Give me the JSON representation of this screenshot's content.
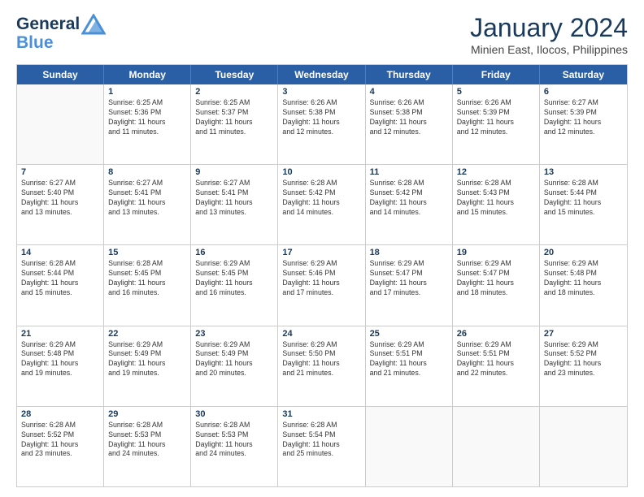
{
  "logo": {
    "line1": "General",
    "line2": "Blue"
  },
  "title": "January 2024",
  "subtitle": "Minien East, Ilocos, Philippines",
  "days": [
    "Sunday",
    "Monday",
    "Tuesday",
    "Wednesday",
    "Thursday",
    "Friday",
    "Saturday"
  ],
  "weeks": [
    [
      {
        "date": "",
        "info": ""
      },
      {
        "date": "1",
        "info": "Sunrise: 6:25 AM\nSunset: 5:36 PM\nDaylight: 11 hours\nand 11 minutes."
      },
      {
        "date": "2",
        "info": "Sunrise: 6:25 AM\nSunset: 5:37 PM\nDaylight: 11 hours\nand 11 minutes."
      },
      {
        "date": "3",
        "info": "Sunrise: 6:26 AM\nSunset: 5:38 PM\nDaylight: 11 hours\nand 12 minutes."
      },
      {
        "date": "4",
        "info": "Sunrise: 6:26 AM\nSunset: 5:38 PM\nDaylight: 11 hours\nand 12 minutes."
      },
      {
        "date": "5",
        "info": "Sunrise: 6:26 AM\nSunset: 5:39 PM\nDaylight: 11 hours\nand 12 minutes."
      },
      {
        "date": "6",
        "info": "Sunrise: 6:27 AM\nSunset: 5:39 PM\nDaylight: 11 hours\nand 12 minutes."
      }
    ],
    [
      {
        "date": "7",
        "info": "Sunrise: 6:27 AM\nSunset: 5:40 PM\nDaylight: 11 hours\nand 13 minutes."
      },
      {
        "date": "8",
        "info": "Sunrise: 6:27 AM\nSunset: 5:41 PM\nDaylight: 11 hours\nand 13 minutes."
      },
      {
        "date": "9",
        "info": "Sunrise: 6:27 AM\nSunset: 5:41 PM\nDaylight: 11 hours\nand 13 minutes."
      },
      {
        "date": "10",
        "info": "Sunrise: 6:28 AM\nSunset: 5:42 PM\nDaylight: 11 hours\nand 14 minutes."
      },
      {
        "date": "11",
        "info": "Sunrise: 6:28 AM\nSunset: 5:42 PM\nDaylight: 11 hours\nand 14 minutes."
      },
      {
        "date": "12",
        "info": "Sunrise: 6:28 AM\nSunset: 5:43 PM\nDaylight: 11 hours\nand 15 minutes."
      },
      {
        "date": "13",
        "info": "Sunrise: 6:28 AM\nSunset: 5:44 PM\nDaylight: 11 hours\nand 15 minutes."
      }
    ],
    [
      {
        "date": "14",
        "info": "Sunrise: 6:28 AM\nSunset: 5:44 PM\nDaylight: 11 hours\nand 15 minutes."
      },
      {
        "date": "15",
        "info": "Sunrise: 6:28 AM\nSunset: 5:45 PM\nDaylight: 11 hours\nand 16 minutes."
      },
      {
        "date": "16",
        "info": "Sunrise: 6:29 AM\nSunset: 5:45 PM\nDaylight: 11 hours\nand 16 minutes."
      },
      {
        "date": "17",
        "info": "Sunrise: 6:29 AM\nSunset: 5:46 PM\nDaylight: 11 hours\nand 17 minutes."
      },
      {
        "date": "18",
        "info": "Sunrise: 6:29 AM\nSunset: 5:47 PM\nDaylight: 11 hours\nand 17 minutes."
      },
      {
        "date": "19",
        "info": "Sunrise: 6:29 AM\nSunset: 5:47 PM\nDaylight: 11 hours\nand 18 minutes."
      },
      {
        "date": "20",
        "info": "Sunrise: 6:29 AM\nSunset: 5:48 PM\nDaylight: 11 hours\nand 18 minutes."
      }
    ],
    [
      {
        "date": "21",
        "info": "Sunrise: 6:29 AM\nSunset: 5:48 PM\nDaylight: 11 hours\nand 19 minutes."
      },
      {
        "date": "22",
        "info": "Sunrise: 6:29 AM\nSunset: 5:49 PM\nDaylight: 11 hours\nand 19 minutes."
      },
      {
        "date": "23",
        "info": "Sunrise: 6:29 AM\nSunset: 5:49 PM\nDaylight: 11 hours\nand 20 minutes."
      },
      {
        "date": "24",
        "info": "Sunrise: 6:29 AM\nSunset: 5:50 PM\nDaylight: 11 hours\nand 21 minutes."
      },
      {
        "date": "25",
        "info": "Sunrise: 6:29 AM\nSunset: 5:51 PM\nDaylight: 11 hours\nand 21 minutes."
      },
      {
        "date": "26",
        "info": "Sunrise: 6:29 AM\nSunset: 5:51 PM\nDaylight: 11 hours\nand 22 minutes."
      },
      {
        "date": "27",
        "info": "Sunrise: 6:29 AM\nSunset: 5:52 PM\nDaylight: 11 hours\nand 23 minutes."
      }
    ],
    [
      {
        "date": "28",
        "info": "Sunrise: 6:28 AM\nSunset: 5:52 PM\nDaylight: 11 hours\nand 23 minutes."
      },
      {
        "date": "29",
        "info": "Sunrise: 6:28 AM\nSunset: 5:53 PM\nDaylight: 11 hours\nand 24 minutes."
      },
      {
        "date": "30",
        "info": "Sunrise: 6:28 AM\nSunset: 5:53 PM\nDaylight: 11 hours\nand 24 minutes."
      },
      {
        "date": "31",
        "info": "Sunrise: 6:28 AM\nSunset: 5:54 PM\nDaylight: 11 hours\nand 25 minutes."
      },
      {
        "date": "",
        "info": ""
      },
      {
        "date": "",
        "info": ""
      },
      {
        "date": "",
        "info": ""
      }
    ]
  ]
}
